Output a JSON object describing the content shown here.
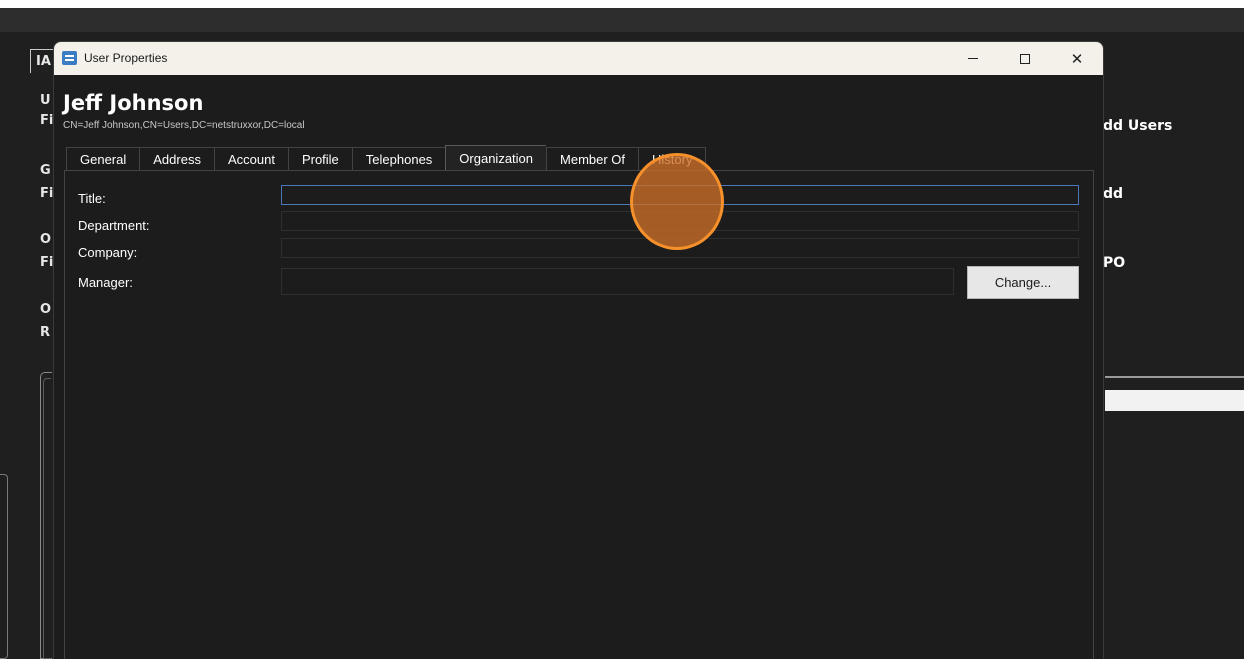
{
  "background": {
    "tab_label": "IA",
    "left_letters": [
      "U",
      "Fi",
      "G",
      "Fi",
      "O",
      "Fi",
      "O",
      "R"
    ],
    "right_labels": [
      "dd Users",
      "dd",
      "PO"
    ]
  },
  "dialog": {
    "title": "User Properties",
    "user_name": "Jeff Johnson",
    "distinguished_name": "CN=Jeff Johnson,CN=Users,DC=netstruxxor,DC=local",
    "tabs": [
      "General",
      "Address",
      "Account",
      "Profile",
      "Telephones",
      "Organization",
      "Member Of",
      "History"
    ],
    "active_tab": "Organization",
    "fields": {
      "title_label": "Title:",
      "title_value": "",
      "department_label": "Department:",
      "department_value": "",
      "company_label": "Company:",
      "company_value": "",
      "manager_label": "Manager:",
      "manager_value": ""
    },
    "change_button": "Change..."
  },
  "colors": {
    "dialog_bg": "#1c1c1c",
    "titlebar_bg": "#f4f1ea",
    "click_indicator": "#f5902b",
    "focus_border": "#4a78b8"
  }
}
